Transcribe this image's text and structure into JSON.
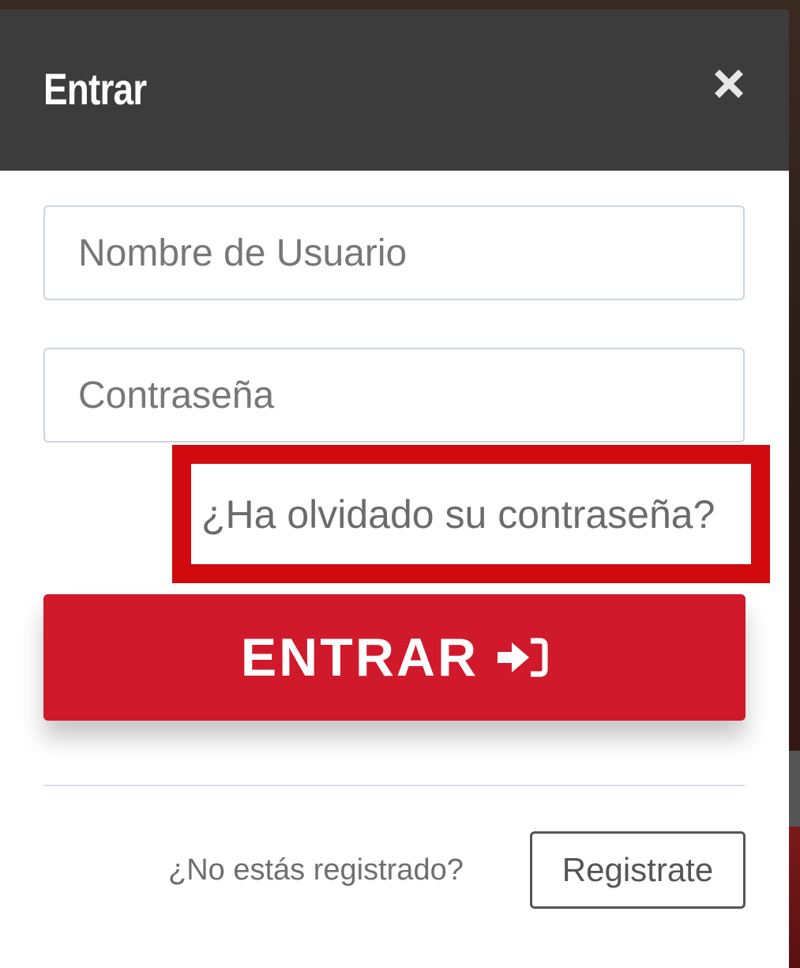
{
  "modal": {
    "title": "Entrar",
    "close_icon": "close-icon"
  },
  "form": {
    "username_placeholder": "Nombre de Usuario",
    "username_value": "",
    "password_placeholder": "Contraseña",
    "password_value": "",
    "forgot_password_label": "¿Ha olvidado su contraseña?",
    "submit_label": "ENTRAR",
    "submit_icon": "sign-in-icon"
  },
  "footer": {
    "register_prompt": "¿No estás registrado?",
    "register_label": "Registrate"
  },
  "colors": {
    "header_bg": "#3c3c3c",
    "accent_red": "#d0192b",
    "highlight_frame": "#d10a10"
  }
}
